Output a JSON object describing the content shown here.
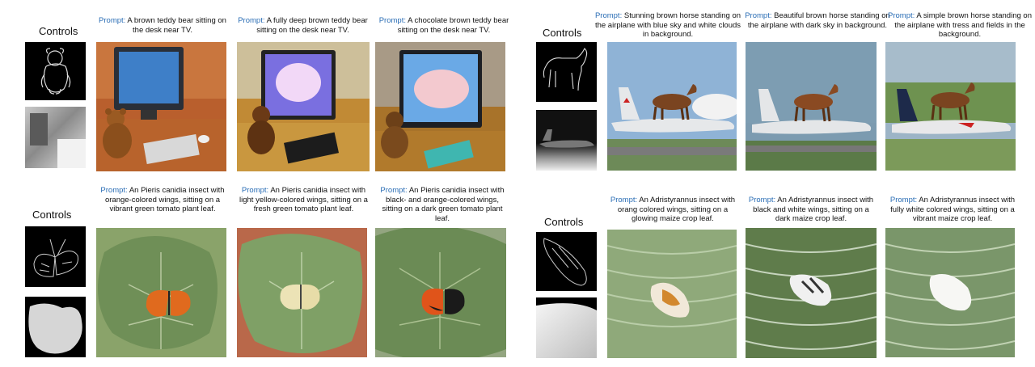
{
  "panels": [
    {
      "controls_label": "Controls",
      "items": [
        {
          "prompt_label": "Prompt:",
          "prompt_text": "A brown teddy bear sitting on the desk near TV."
        },
        {
          "prompt_label": "Prompt:",
          "prompt_text": "A fully deep brown teddy bear sitting on the desk near TV."
        },
        {
          "prompt_label": "Prompt:",
          "prompt_text": "A chocolate brown teddy bear sitting on the desk near TV."
        }
      ]
    },
    {
      "controls_label": "Controls",
      "items": [
        {
          "prompt_label": "Prompt:",
          "prompt_text": "Stunning brown horse standing on the airplane with blue sky and white clouds in background."
        },
        {
          "prompt_label": "Prompt:",
          "prompt_text": "Beautiful brown horse standing on the airplane with dark sky in background."
        },
        {
          "prompt_label": "Prompt:",
          "prompt_text": "A simple brown horse standing on the airplane with tress and fields in the background."
        }
      ]
    },
    {
      "controls_label": "Controls",
      "items": [
        {
          "prompt_label": "Prompt:",
          "prompt_text": "An Pieris canidia insect with orange-colored wings, sitting on a vibrant green tomato plant leaf."
        },
        {
          "prompt_label": "Prompt:",
          "prompt_text": "An Pieris canidia insect with light yellow-colored wings, sitting on a fresh green tomato plant leaf."
        },
        {
          "prompt_label": "Prompt:",
          "prompt_text": "An Pieris canidia insect with black- and orange-colored wings, sitting on a dark green tomato plant leaf."
        }
      ]
    },
    {
      "controls_label": "Controls",
      "items": [
        {
          "prompt_label": "Prompt:",
          "prompt_text": "An Adristyrannus insect with orang colored wings, sitting on a glowing maize crop leaf."
        },
        {
          "prompt_label": "Prompt:",
          "prompt_text": "An Adristyrannus insect with black and white wings, sitting on a dark maize crop leaf."
        },
        {
          "prompt_label": "Prompt:",
          "prompt_text": "An Adristyrannus insect with fully white colored wings, sitting on a vibrant maize crop leaf."
        }
      ]
    }
  ],
  "colors": {
    "prompt_keyword": "#2a6db5"
  }
}
